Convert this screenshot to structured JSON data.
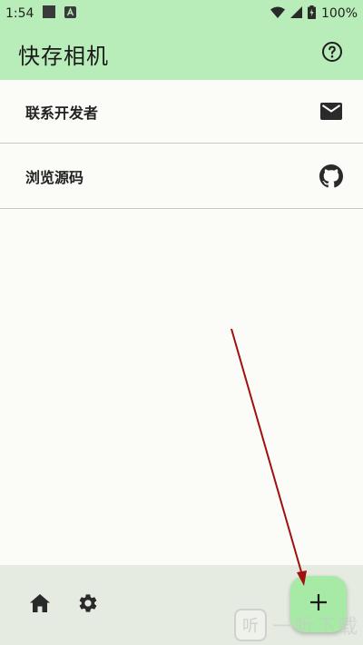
{
  "status_bar": {
    "time": "1:54",
    "battery": "100%",
    "icons": [
      "stop-square-icon",
      "a-badge-icon",
      "wifi-icon",
      "signal-icon",
      "battery-charging-icon"
    ]
  },
  "app_bar": {
    "title": "快存相机",
    "help_icon": "help-circle-icon"
  },
  "list": {
    "items": [
      {
        "label": "联系开发者",
        "icon": "mail-icon"
      },
      {
        "label": "浏览源码",
        "icon": "github-icon"
      }
    ]
  },
  "bottom_bar": {
    "icons": [
      "home-icon",
      "settings-gear-icon"
    ],
    "fab_icon": "plus-icon"
  },
  "watermark": {
    "badge": "听",
    "text": "一听下载"
  },
  "colors": {
    "app_bar_bg": "#b8ecb8",
    "page_bg": "#fbfcf7",
    "bottom_bar_bg": "#e5ebe1",
    "fab_bg": "#a6eaa6",
    "annotation_arrow": "#a01010"
  }
}
